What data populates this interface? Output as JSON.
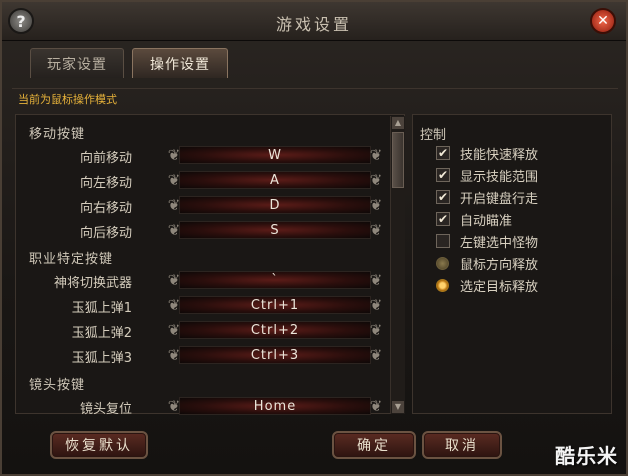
{
  "window": {
    "title": "游戏设置"
  },
  "tabs": [
    {
      "label": "玩家设置"
    },
    {
      "label": "操作设置"
    }
  ],
  "mode_text": "当前为鼠标操作模式",
  "keybinds": {
    "sections": [
      "移动按键",
      "职业特定按键",
      "镜头按键"
    ],
    "items": [
      {
        "label": "向前移动",
        "value": "W"
      },
      {
        "label": "向左移动",
        "value": "A"
      },
      {
        "label": "向右移动",
        "value": "D"
      },
      {
        "label": "向后移动",
        "value": "S"
      },
      {
        "label": "神将切换武器",
        "value": "`"
      },
      {
        "label": "玉狐上弹1",
        "value": "Ctrl+1"
      },
      {
        "label": "玉狐上弹2",
        "value": "Ctrl+2"
      },
      {
        "label": "玉狐上弹3",
        "value": "Ctrl+3"
      },
      {
        "label": "镜头复位",
        "value": "Home"
      }
    ]
  },
  "control": {
    "title": "控制",
    "checkboxes": [
      {
        "label": "技能快速释放",
        "checked": true
      },
      {
        "label": "显示技能范围",
        "checked": true
      },
      {
        "label": "开启键盘行走",
        "checked": true
      },
      {
        "label": "自动瞄准",
        "checked": true
      },
      {
        "label": "左键选中怪物",
        "checked": false
      }
    ],
    "radios": [
      {
        "label": "鼠标方向释放",
        "selected": false
      },
      {
        "label": "选定目标释放",
        "selected": true
      }
    ]
  },
  "buttons": {
    "reset": "恢复默认",
    "ok": "确定",
    "cancel": "取消"
  },
  "watermark": "酷乐米",
  "icons": {
    "help": "help-icon",
    "close": "close-icon",
    "ornament": "ornament-icon",
    "check": "check-icon"
  }
}
